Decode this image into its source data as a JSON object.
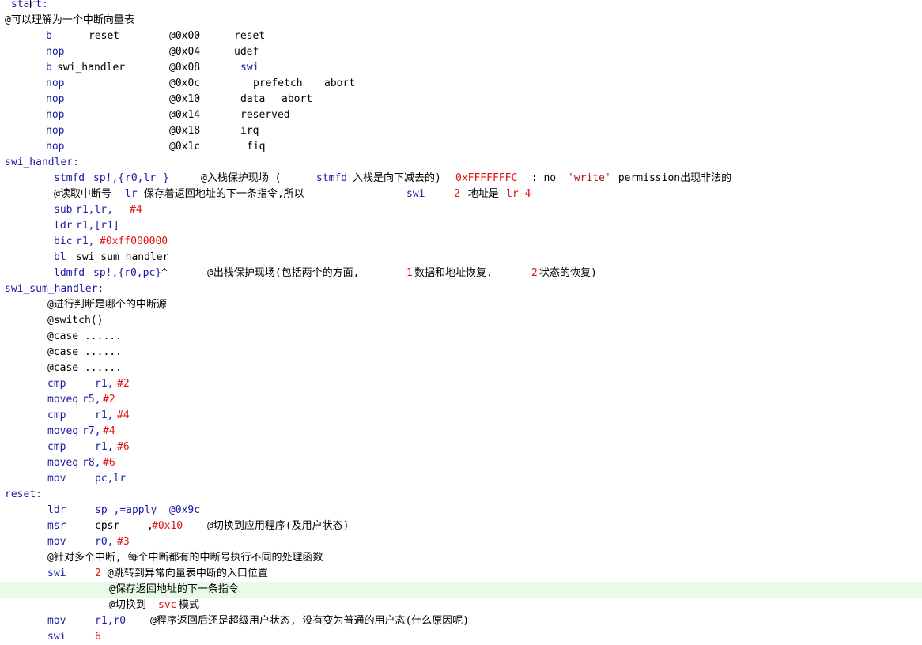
{
  "editor": {
    "title": "",
    "current_line_index": 37,
    "lines": [
      [
        [
          "_start:",
          "lbl",
          6
        ]
      ],
      [
        [
          "@可以理解为一个中断向量表",
          "txt",
          6
        ]
      ],
      [
        [
          "b",
          "kw",
          58
        ],
        [
          "reset",
          "txt",
          112
        ],
        [
          "@0x00",
          "txt",
          214
        ],
        [
          "reset",
          "txt",
          296
        ]
      ],
      [
        [
          "nop",
          "kw",
          58
        ],
        [
          "@0x04",
          "txt",
          214
        ],
        [
          "udef",
          "txt",
          296
        ]
      ],
      [
        [
          "b",
          "kw",
          58
        ],
        [
          "swi_handler",
          "txt",
          72
        ],
        [
          "@0x08",
          "txt",
          214
        ],
        [
          "swi",
          "kw",
          304
        ]
      ],
      [
        [
          "nop",
          "kw",
          58
        ],
        [
          "@0x0c",
          "txt",
          214
        ],
        [
          "prefetch",
          "txt",
          320
        ],
        [
          "abort",
          "txt",
          410
        ]
      ],
      [
        [
          "nop",
          "kw",
          58
        ],
        [
          "@0x10",
          "txt",
          214
        ],
        [
          "data",
          "txt",
          304
        ],
        [
          "abort",
          "txt",
          356
        ]
      ],
      [
        [
          "nop",
          "kw",
          58
        ],
        [
          "@0x14",
          "txt",
          214
        ],
        [
          "reserved",
          "txt",
          304
        ]
      ],
      [
        [
          "nop",
          "kw",
          58
        ],
        [
          "@0x18",
          "txt",
          214
        ],
        [
          "irq",
          "txt",
          304
        ]
      ],
      [
        [
          "nop",
          "kw",
          58
        ],
        [
          "@0x1c",
          "txt",
          214
        ],
        [
          "fiq",
          "txt",
          312
        ]
      ],
      [
        [
          "swi_handler:",
          "lbl",
          6
        ]
      ],
      [
        [
          "stmfd",
          "kw",
          68
        ],
        [
          "sp!,{",
          "reg",
          118
        ],
        [
          "r0,lr",
          "reg",
          158
        ],
        [
          "}",
          "reg",
          206
        ],
        [
          "@入栈保护现场 (",
          "txt",
          254
        ],
        [
          "stmfd",
          "kw",
          400
        ],
        [
          "入栈是向下减去的)",
          "txt",
          446
        ],
        [
          "0xFFFFFFFC",
          "num",
          576
        ],
        [
          " : no ",
          "txt",
          664
        ],
        [
          "'write'",
          "str",
          718
        ],
        [
          " permission出现非法的",
          "txt",
          774
        ]
      ],
      [
        [
          "@读取中断号",
          "txt",
          68
        ],
        [
          "lr",
          "reg",
          158
        ],
        [
          " 保存着返回地址的下一条指令,所以",
          "txt",
          174
        ],
        [
          "swi",
          "kw",
          514
        ],
        [
          "2",
          "num",
          574
        ],
        [
          " 地址是",
          "txt",
          584
        ],
        [
          "lr-4",
          "num",
          640
        ]
      ],
      [
        [
          "sub",
          "kw",
          68
        ],
        [
          "r1,lr,",
          "reg",
          96
        ],
        [
          "#4",
          "num",
          164
        ]
      ],
      [
        [
          "ldr",
          "kw",
          68
        ],
        [
          "r1,[r1]",
          "reg",
          96
        ]
      ],
      [
        [
          "bic",
          "kw",
          68
        ],
        [
          "r1,",
          "reg",
          96
        ],
        [
          "#0xff000000",
          "num",
          126
        ]
      ],
      [
        [
          "bl",
          "kw",
          68
        ],
        [
          "swi_sum_handler",
          "txt",
          96
        ]
      ],
      [
        [
          "ldmfd",
          "kw",
          68
        ],
        [
          "sp!,{r0,pc}",
          "reg",
          118
        ],
        [
          "^",
          "txt",
          204
        ],
        [
          "@出栈保护现场(包括两个的方面,",
          "txt",
          262
        ],
        [
          "1",
          "num",
          514
        ],
        [
          "数据和地址恢复,",
          "txt",
          524
        ],
        [
          "2",
          "num",
          672
        ],
        [
          "状态的恢复)",
          "txt",
          682
        ]
      ],
      [
        [
          "swi_sum_handler:",
          "lbl",
          6
        ]
      ],
      [
        [
          "@进行判断是哪个的中断源",
          "txt",
          60
        ]
      ],
      [
        [
          "@switch()",
          "txt",
          60
        ]
      ],
      [
        [
          "@case ......",
          "txt",
          60
        ]
      ],
      [
        [
          "@case ......",
          "txt",
          60
        ]
      ],
      [
        [
          "@case ......",
          "txt",
          60
        ]
      ],
      [
        [
          "cmp",
          "kw",
          60
        ],
        [
          "r1,",
          "reg",
          120
        ],
        [
          "#2",
          "num",
          148
        ]
      ],
      [
        [
          "moveq",
          "kw",
          60
        ],
        [
          "r5,",
          "reg",
          104
        ],
        [
          "#2",
          "num",
          130
        ]
      ],
      [
        [
          "cmp",
          "kw",
          60
        ],
        [
          "r1,",
          "reg",
          120
        ],
        [
          "#4",
          "num",
          148
        ]
      ],
      [
        [
          "moveq",
          "kw",
          60
        ],
        [
          "r7,",
          "reg",
          104
        ],
        [
          "#4",
          "num",
          130
        ]
      ],
      [
        [
          "cmp",
          "kw",
          60
        ],
        [
          "r1,",
          "reg",
          120
        ],
        [
          "#6",
          "num",
          148
        ]
      ],
      [
        [
          "moveq",
          "kw",
          60
        ],
        [
          "r8,",
          "reg",
          104
        ],
        [
          "#6",
          "num",
          130
        ]
      ],
      [
        [
          "mov",
          "kw",
          60
        ],
        [
          "pc,lr",
          "reg",
          120
        ]
      ],
      [
        [
          "reset:",
          "lbl",
          6
        ]
      ],
      [
        [
          "ldr",
          "kw",
          60
        ],
        [
          "sp ,=apply  @0x9c",
          "reg",
          120
        ]
      ],
      [
        [
          "msr",
          "kw",
          60
        ],
        [
          "cpsr",
          "txt",
          120
        ],
        [
          ",",
          "txt",
          186
        ],
        [
          "#0x10",
          "num",
          192
        ],
        [
          "@切换到应用程序(及用户状态)",
          "txt",
          262
        ]
      ],
      [
        [
          "mov",
          "kw",
          60
        ],
        [
          "r0,",
          "reg",
          120
        ],
        [
          "#3",
          "num",
          148
        ]
      ],
      [
        [
          "@针对多个中断, 每个中断都有的中断号执行不同的处理函数",
          "txt",
          60
        ]
      ],
      [
        [
          "swi",
          "kw",
          60
        ],
        [
          "2",
          "num",
          120
        ],
        [
          "@跳转到异常向量表中断的入口位置",
          "txt",
          136
        ]
      ],
      [
        [
          "@保存返回地址的下一条指令",
          "txt",
          138
        ]
      ],
      [
        [
          "@切换到",
          "txt",
          138
        ],
        [
          "svc",
          "num",
          200
        ],
        [
          "模式",
          "txt",
          226
        ]
      ],
      [
        [
          "mov",
          "kw",
          60
        ],
        [
          "r1,r0",
          "reg",
          120
        ],
        [
          "@程序返回后还是超级用户状态, 没有变为普通的用户态(什么原因呢)",
          "txt",
          190
        ]
      ],
      [
        [
          "swi",
          "kw",
          60
        ],
        [
          "6",
          "num",
          120
        ]
      ]
    ]
  }
}
